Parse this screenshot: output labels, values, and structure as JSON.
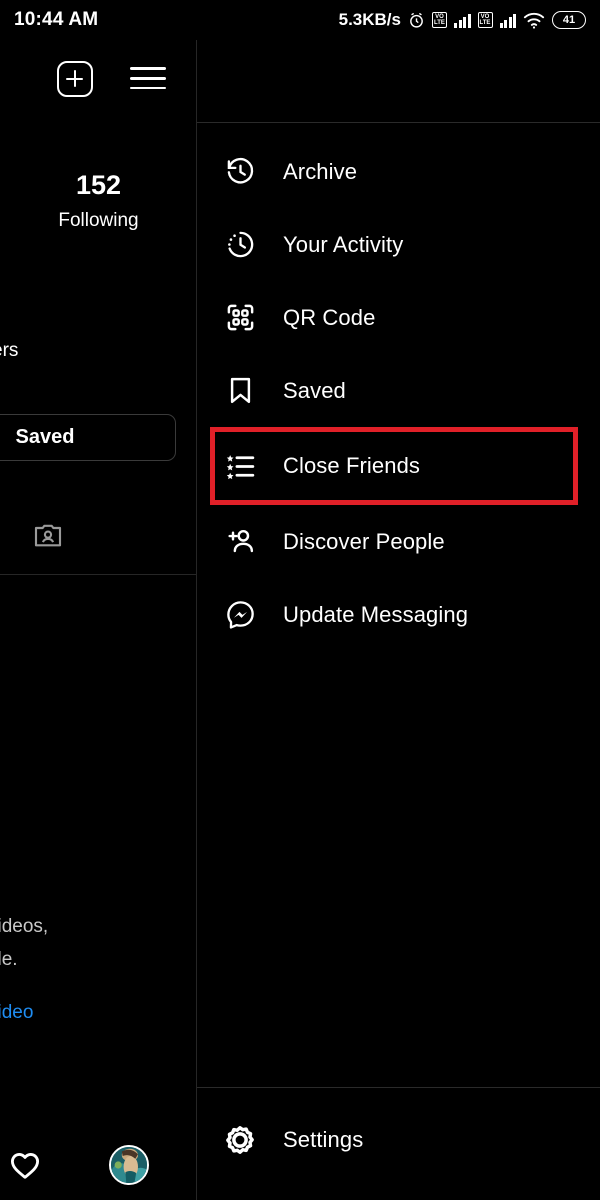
{
  "statusbar": {
    "time": "10:44 AM",
    "network_speed": "5.3KB/s",
    "alarm_icon": "alarm-clock-icon",
    "sim1_label": "VO\nLTE",
    "sim1_top": "VO",
    "sim1_bottom": "LTE",
    "sim2_top": "VO",
    "sim2_bottom": "LTE",
    "wifi_icon": "wifi-icon",
    "battery_level": "41"
  },
  "profile": {
    "new_post_icon": "plus-square-icon",
    "menu_icon": "hamburger-menu-icon",
    "following_count": "152",
    "following_label": "Following",
    "followers_label_partial": "ers",
    "saved_button_label": "Saved",
    "tagged_icon": "tagged-photos-icon",
    "bio_line_1": "videos,",
    "bio_line_2": "file.",
    "bio_link": "video",
    "nav_heart_icon": "heart-icon",
    "nav_avatar": "profile-avatar"
  },
  "menu": {
    "items": [
      {
        "label": "Archive",
        "icon": "archive-clock-icon",
        "highlighted": false
      },
      {
        "label": "Your Activity",
        "icon": "activity-clock-icon",
        "highlighted": false
      },
      {
        "label": "QR Code",
        "icon": "qr-code-icon",
        "highlighted": false
      },
      {
        "label": "Saved",
        "icon": "bookmark-icon",
        "highlighted": false
      },
      {
        "label": "Close Friends",
        "icon": "star-list-icon",
        "highlighted": true
      },
      {
        "label": "Discover People",
        "icon": "person-add-icon",
        "highlighted": false
      },
      {
        "label": "Update Messaging",
        "icon": "messenger-icon",
        "highlighted": false
      }
    ],
    "settings": {
      "label": "Settings",
      "icon": "gear-icon"
    }
  },
  "colors": {
    "background": "#000000",
    "text": "#ffffff",
    "highlight_red": "#e02028",
    "link_blue": "#1f8df2",
    "divider": "#2a2a2a"
  }
}
